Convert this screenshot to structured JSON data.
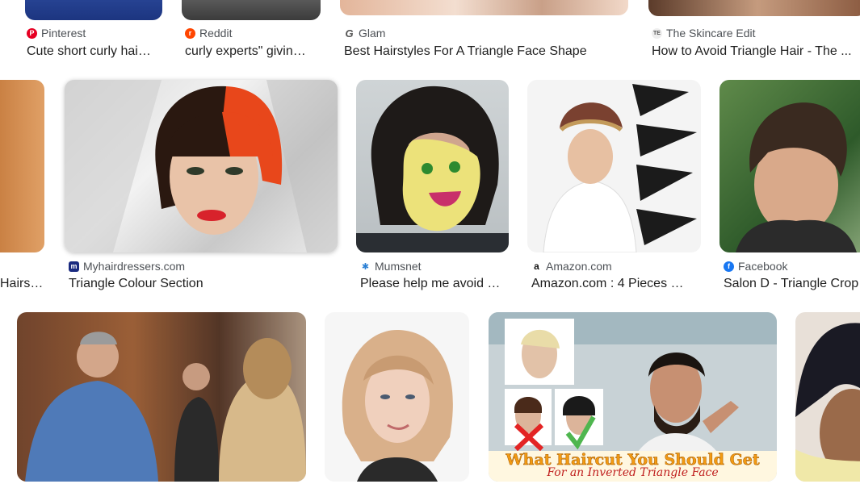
{
  "row1": [
    {
      "source": "Pinterest",
      "title": "Cute short curly hai…",
      "icon": "pinterest-icon",
      "color": "#e60023"
    },
    {
      "source": "Reddit",
      "title": "curly experts\" givin…",
      "icon": "reddit-icon",
      "color": "#ff4500"
    },
    {
      "source": "Glam",
      "title": "Best Hairstyles For A Triangle Face Shape",
      "icon": "glam-icon",
      "color": "#555555"
    },
    {
      "source": "The Skincare Edit",
      "title": "How to Avoid Triangle Hair - The ...",
      "icon": "skincare-edit-icon",
      "color": "#777777"
    }
  ],
  "row2": [
    {
      "source": "",
      "title": "Hairs…",
      "icon": "",
      "color": ""
    },
    {
      "source": "Myhairdressers.com",
      "title": "Triangle Colour Section",
      "icon": "myhairdressers-icon",
      "color": "#1a2a80"
    },
    {
      "source": "Mumsnet",
      "title": "Please help me avoid …",
      "icon": "mumsnet-icon",
      "color": "#2a7fd4"
    },
    {
      "source": "Amazon.com",
      "title": "Amazon.com : 4 Pieces …",
      "icon": "amazon-icon",
      "color": "#111111"
    },
    {
      "source": "Facebook",
      "title": "Salon D - Triangle Crop",
      "icon": "facebook-icon",
      "color": "#1877f2"
    }
  ],
  "row3": {
    "overlay_title": "What Haircut You Should Get",
    "overlay_subtitle": "For an Inverted Triangle Face"
  }
}
